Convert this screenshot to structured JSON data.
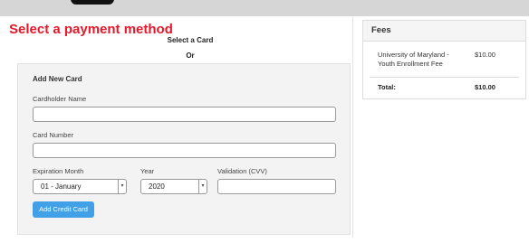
{
  "page": {
    "title": "Select a payment method",
    "select_card_label": "Select a Card",
    "or_label": "Or"
  },
  "card_form": {
    "heading": "Add New Card",
    "cardholder_label": "Cardholder Name",
    "cardholder_value": "",
    "card_number_label": "Card Number",
    "card_number_value": "",
    "exp_month_label": "Expiration Month",
    "exp_month_value": "01 - January",
    "year_label": "Year",
    "year_value": "2020",
    "cvv_label": "Validation (CVV)",
    "cvv_value": "",
    "submit_label": "Add Credit Card"
  },
  "fees": {
    "title": "Fees",
    "items": [
      {
        "name": "University of Maryland - Youth Enrollment Fee",
        "amount": "$10.00"
      }
    ],
    "total_label": "Total:",
    "total_amount": "$10.00"
  },
  "colors": {
    "title_red": "#e8182a",
    "button_blue": "#42a0e6",
    "form_bg": "#f3f3f3"
  }
}
